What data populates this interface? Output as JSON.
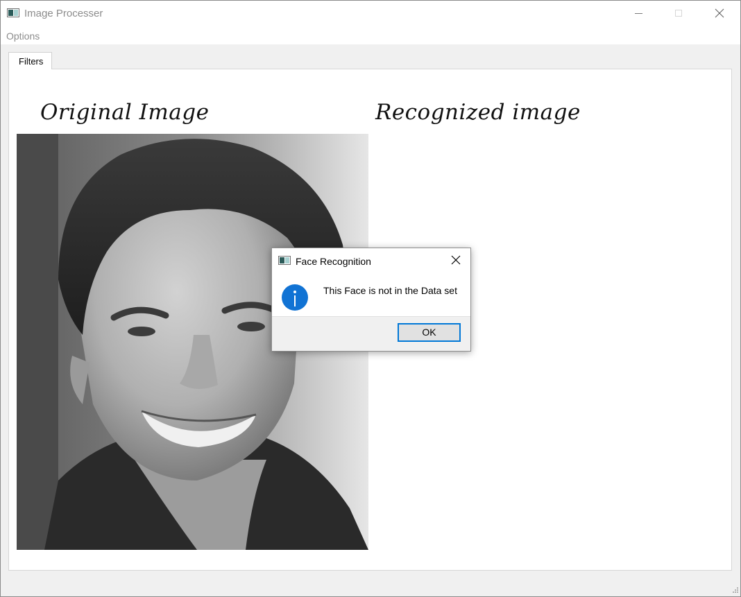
{
  "window": {
    "title": "Image Processer",
    "icon": "app-window-icon"
  },
  "menubar": {
    "items": [
      {
        "label": "Options"
      }
    ]
  },
  "tabs": [
    {
      "label": "Filters",
      "active": true
    }
  ],
  "panel": {
    "original_label": "Original Image",
    "recognized_label": "Recognized image"
  },
  "dialog": {
    "title": "Face Recognition",
    "message": "This Face is not in the Data set",
    "icon": "info-icon",
    "ok_label": "OK"
  },
  "colors": {
    "accent": "#0078d7",
    "info_icon": "#1173d4"
  }
}
